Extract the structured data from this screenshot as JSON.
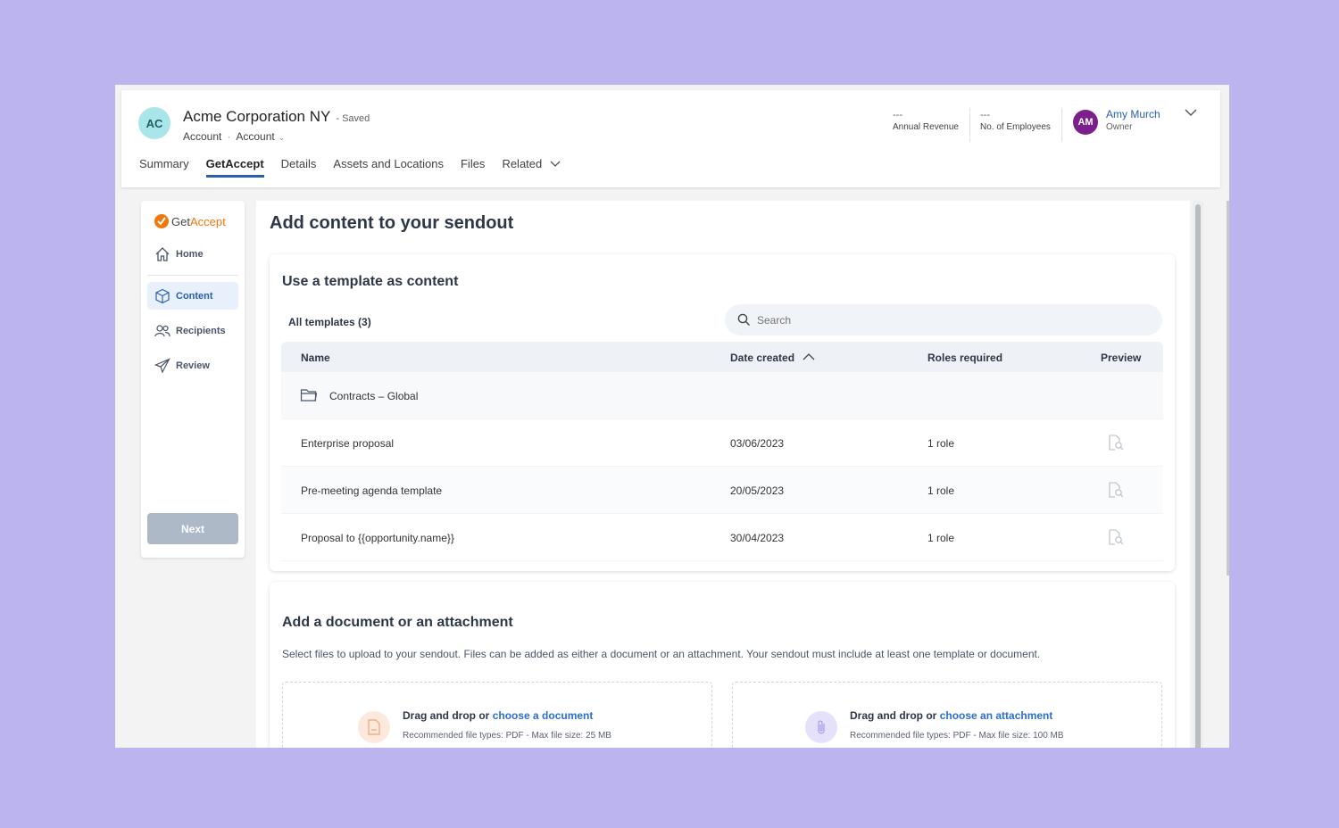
{
  "record": {
    "initials": "AC",
    "title": "Acme Corporation NY",
    "saved": "- Saved",
    "crumb1": "Account",
    "crumb2": "Account"
  },
  "kpis": [
    {
      "value": "---",
      "label": "Annual Revenue"
    },
    {
      "value": "---",
      "label": "No. of Employees"
    }
  ],
  "owner": {
    "initials": "AM",
    "name": "Amy Murch",
    "role": "Owner"
  },
  "tabs": [
    "Summary",
    "GetAccept",
    "Details",
    "Assets and Locations",
    "Files",
    "Related"
  ],
  "sidebar": {
    "logo_part1": "Get",
    "logo_part2": "Accept",
    "items": [
      "Home",
      "Content",
      "Recipients",
      "Review"
    ],
    "next": "Next"
  },
  "main": {
    "title": "Add content to your sendout"
  },
  "templates": {
    "title": "Use a template as content",
    "all": "All templates (3)",
    "search_placeholder": "Search",
    "columns": {
      "name": "Name",
      "date": "Date created",
      "roles": "Roles required",
      "preview": "Preview"
    },
    "folder": "Contracts – Global",
    "rows": [
      {
        "name": "Enterprise proposal",
        "date": "03/06/2023",
        "roles": "1 role"
      },
      {
        "name": "Pre-meeting agenda template",
        "date": "20/05/2023",
        "roles": "1 role"
      },
      {
        "name": "Proposal to {{opportunity.name}}",
        "date": "30/04/2023",
        "roles": "1 role"
      }
    ]
  },
  "attach": {
    "title": "Add a document or an attachment",
    "desc": "Select files to upload to your sendout. Files can be added as either a document or an attachment. Your sendout must include at least one template or document.",
    "doc_prefix": "Drag and drop or",
    "doc_link": "choose a document",
    "doc_sub": "Recommended file types: PDF - Max file size: 25 MB",
    "att_prefix": "Drag and drop or",
    "att_link": "choose an attachment",
    "att_sub": "Recommended file types: PDF - Max file size: 100 MB"
  },
  "colors": {
    "accent": "#2a5fb0",
    "brand": "#f0780a",
    "highlight": "#ee6a1c",
    "background": "#bcb4ee"
  }
}
